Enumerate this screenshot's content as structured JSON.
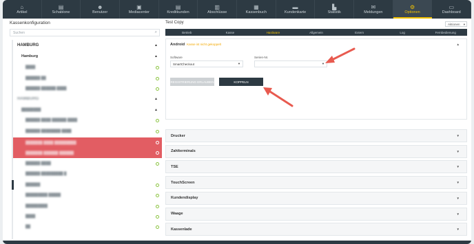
{
  "nav": {
    "items": [
      {
        "label": "Artikel",
        "icon": "tag-icon",
        "glyph": "⌂"
      },
      {
        "label": "Schablone",
        "icon": "document-icon",
        "glyph": "▤"
      },
      {
        "label": "Benutzer",
        "icon": "users-icon",
        "glyph": "☻"
      },
      {
        "label": "Mediacenter",
        "icon": "media-icon",
        "glyph": "▣"
      },
      {
        "label": "Kreditkunden",
        "icon": "card-icon",
        "glyph": "▤"
      },
      {
        "label": "Abschlüsse",
        "icon": "report-icon",
        "glyph": "▥"
      },
      {
        "label": "Kassenbuch",
        "icon": "book-icon",
        "glyph": "▦"
      },
      {
        "label": "Kundenkarte",
        "icon": "customer-card-icon",
        "glyph": "▬"
      },
      {
        "label": "Statistik",
        "icon": "chart-icon",
        "glyph": "▙"
      },
      {
        "label": "Meldungen",
        "icon": "mail-icon",
        "glyph": "✉"
      },
      {
        "label": "Optionen",
        "icon": "gear-icon",
        "glyph": "⚙"
      },
      {
        "label": "Dashboard",
        "icon": "monitor-icon",
        "glyph": "▭"
      }
    ],
    "active_index": 10,
    "accent": "#f3c200"
  },
  "left": {
    "title": "Kassenkonfiguration",
    "search_placeholder": "Suchen",
    "group_main": "HAMBURG",
    "group_sub": "Hamburg",
    "group_other": "HAMBURG"
  },
  "right": {
    "title": "Test Copy",
    "actions": "Aktionen",
    "tabs": [
      "Betrieb",
      "Kasse",
      "Hardware",
      "Allgemein",
      "Extern",
      "Log",
      "Fernbedienung"
    ],
    "active_tab": 2,
    "android": {
      "title": "Android",
      "note": "Kasse ist nicht gekoppelt",
      "software_label": "Software",
      "software_value": "SmartCheckout",
      "serial_label": "Serien-Nr.",
      "serial_value": "",
      "btn_allow": "REGISTRIERUNG ERLAUBEN",
      "btn_pair": "KOPPELN"
    },
    "sections": [
      "Drucker",
      "Zahlterminals",
      "TSE",
      "TouchScreen",
      "Kundendisplay",
      "Waage",
      "Kassenlade"
    ]
  }
}
